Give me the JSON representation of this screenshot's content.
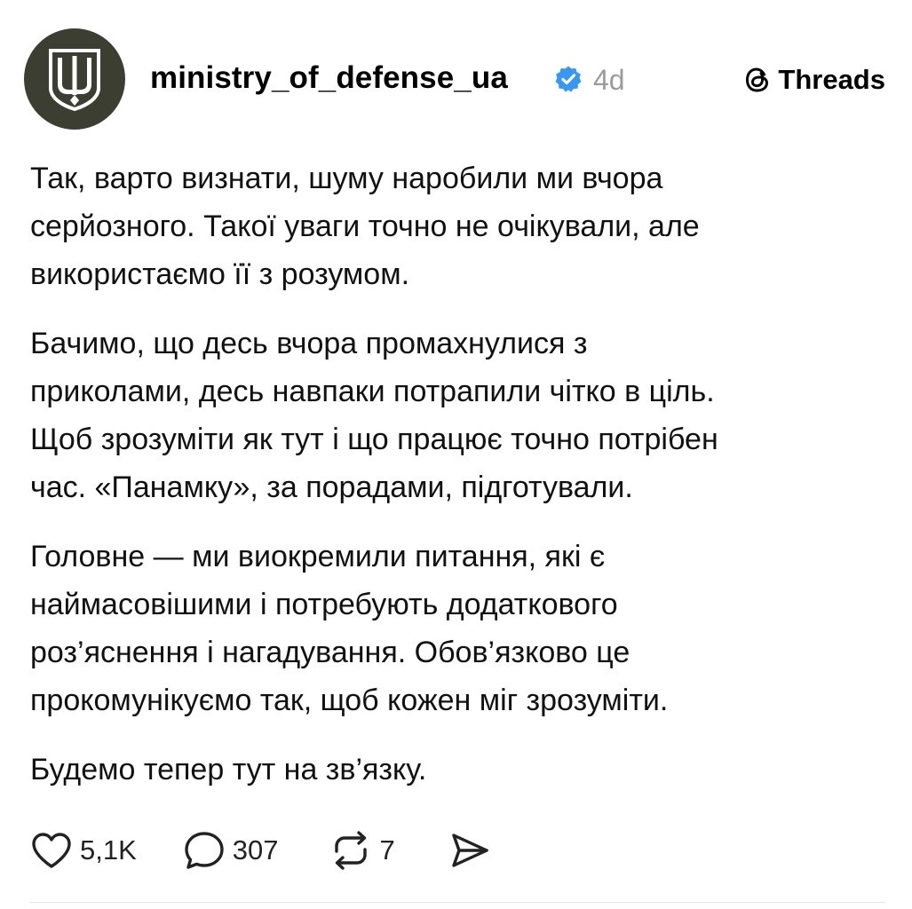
{
  "post": {
    "author": {
      "username": "ministry_of_defense_ua",
      "verified": true,
      "avatar_icon": "trident-emblem-icon",
      "avatar_bg": "#3d3e32",
      "avatar_fg": "#ffffff"
    },
    "time_ago": "4d",
    "brand": {
      "icon": "threads-logo-icon",
      "label": "Threads"
    },
    "paragraphs": [
      "Так, варто визнати, шуму наробили ми вчора\nсерйозного. Такої уваги точно не очікували, але\nвикористаємо її з розумом.",
      "Бачимо, що десь вчора промахнулися з\nприколами, десь навпаки потрапили чітко в ціль.\nЩоб зрозуміти як тут і що працює точно потрібен\nчас. «Панамку», за порадами, підготували.",
      "Головне — ми виокремили питання, які є\nнаймасовішими і потребують додаткового\nроз’яснення і нагадування. Обов’язково це\nпрокомунікуємо так, щоб кожен міг зрозуміти.",
      "Будемо тепер тут на зв’язку."
    ],
    "actions": {
      "like": {
        "icon": "heart-icon",
        "count": "5,1K"
      },
      "reply": {
        "icon": "comment-bubble-icon",
        "count": "307"
      },
      "repost": {
        "icon": "repost-icon",
        "count": "7"
      },
      "share": {
        "icon": "send-icon"
      }
    },
    "colors": {
      "verified_badge": "#3897f0",
      "muted_text": "#9b9b9b"
    }
  }
}
